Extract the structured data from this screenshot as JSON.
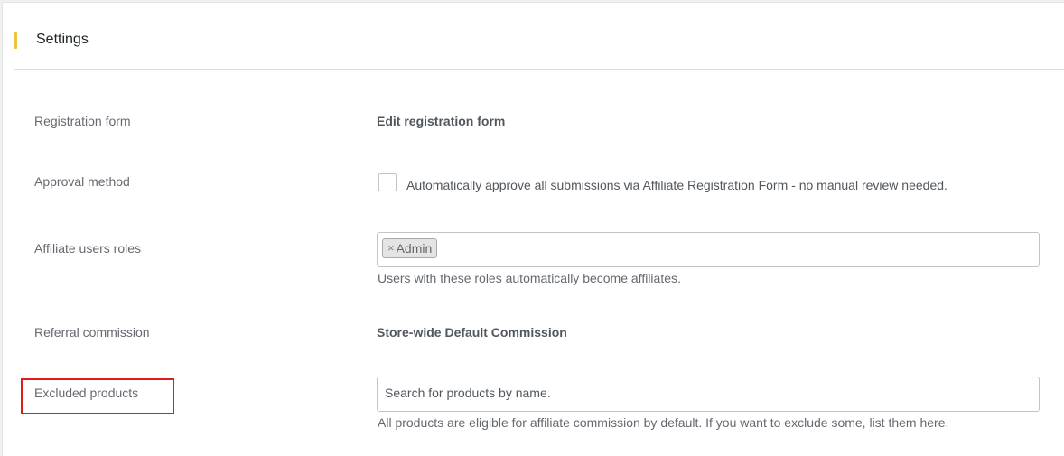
{
  "header": {
    "title": "Settings"
  },
  "rows": {
    "registration_form": {
      "label": "Registration form",
      "link": "Edit registration form"
    },
    "approval_method": {
      "label": "Approval method",
      "checkbox_label": "Automatically approve all submissions via Affiliate Registration Form - no manual review needed.",
      "checked": false
    },
    "affiliate_roles": {
      "label": "Affiliate users roles",
      "tags": [
        "Admin"
      ],
      "tag_remove": "×",
      "description": "Users with these roles automatically become affiliates."
    },
    "referral_commission": {
      "label": "Referral commission",
      "link": "Store-wide Default Commission"
    },
    "excluded_products": {
      "label": "Excluded products",
      "placeholder": "Search for products by name.",
      "description": "All products are eligible for affiliate commission by default. If you want to exclude some, list them here."
    }
  },
  "colors": {
    "accent": "#f0c33c",
    "highlight": "#e01b1b"
  }
}
